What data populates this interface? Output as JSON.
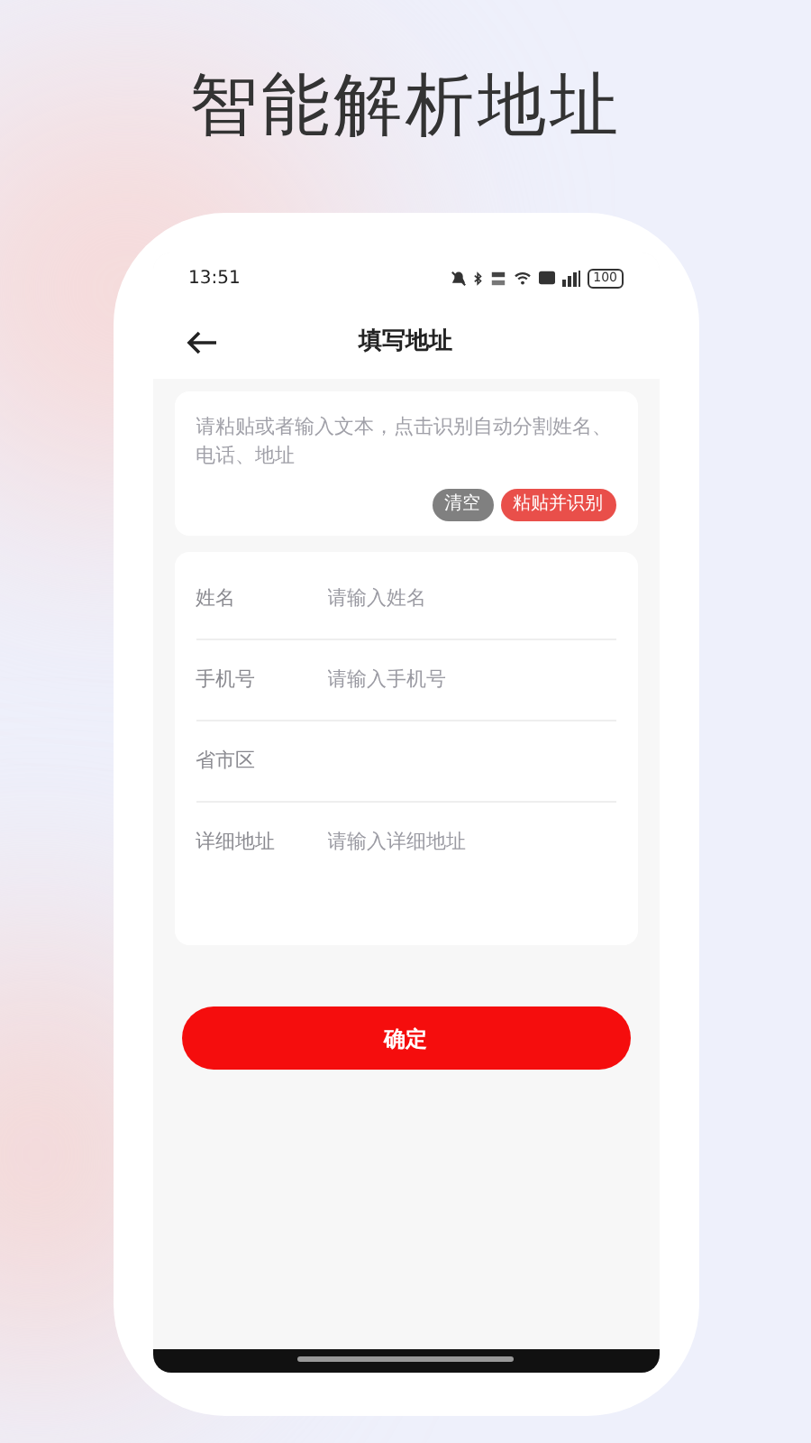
{
  "headline": "智能解析地址",
  "status_bar": {
    "time": "13:51",
    "battery": "100"
  },
  "nav": {
    "title": "填写地址"
  },
  "paste_box": {
    "placeholder": "请粘贴或者输入文本，点击识别自动分割姓名、电话、地址",
    "buttons": [
      {
        "label": "清空",
        "kind": "secondary"
      },
      {
        "label": "粘贴并识别",
        "kind": "primary"
      }
    ]
  },
  "form": {
    "fields": [
      {
        "label": "姓名",
        "placeholder": "请输入姓名",
        "kind": "input"
      },
      {
        "label": "手机号",
        "placeholder": "请输入手机号",
        "kind": "input"
      },
      {
        "label": "省市区",
        "kind": "picker"
      },
      {
        "label": "详细地址",
        "placeholder": "请输入详细地址",
        "kind": "textarea"
      }
    ]
  },
  "submit": {
    "label": "确定"
  }
}
